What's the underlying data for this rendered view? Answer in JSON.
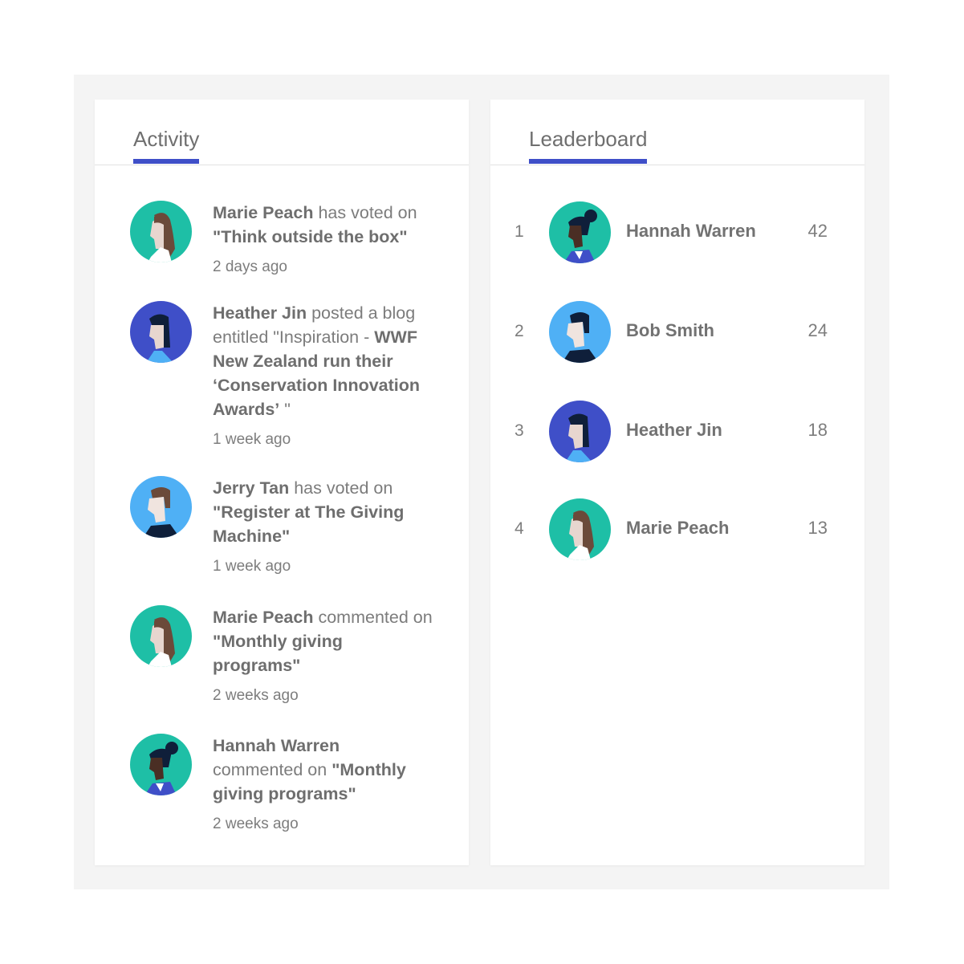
{
  "activity": {
    "tab_label": "Activity",
    "items": [
      {
        "avatar": "marie-peach-avatar",
        "name": "Marie Peach",
        "action": "has voted on",
        "target": "\"Think outside the box\"",
        "time": "2 days ago"
      },
      {
        "avatar": "heather-jin-avatar",
        "name": "Heather Jin",
        "action": "posted a blog entitled \"Inspiration -",
        "target": "WWF New Zealand run their ‘Conservation Innovation Awards’",
        "suffix": "\"",
        "time": "1 week ago"
      },
      {
        "avatar": "jerry-tan-avatar",
        "name": "Jerry Tan",
        "action": "has voted on",
        "target": "\"Register at The Giving Machine\"",
        "time": "1 week ago"
      },
      {
        "avatar": "marie-peach-avatar",
        "name": "Marie Peach",
        "action": "commented on",
        "target": "\"Monthly giving programs\"",
        "time": "2 weeks ago"
      },
      {
        "avatar": "hannah-warren-avatar",
        "name": "Hannah Warren",
        "action": "commented on",
        "target": "\"Monthly giving programs\"",
        "time": "2 weeks ago"
      }
    ]
  },
  "leaderboard": {
    "tab_label": "Leaderboard",
    "rows": [
      {
        "rank": "1",
        "avatar": "hannah-warren-avatar",
        "name": "Hannah Warren",
        "score": "42"
      },
      {
        "rank": "2",
        "avatar": "bob-smith-avatar",
        "name": "Bob Smith",
        "score": "24"
      },
      {
        "rank": "3",
        "avatar": "heather-jin-avatar",
        "name": "Heather Jin",
        "score": "18"
      },
      {
        "rank": "4",
        "avatar": "marie-peach-avatar",
        "name": "Marie Peach",
        "score": "13"
      }
    ]
  },
  "colors": {
    "accent": "#3f4fc8",
    "teal": "#1ebfa6",
    "indigo": "#3f4fc8",
    "sky": "#4fb0f5",
    "frame_bg": "#f4f4f4"
  }
}
